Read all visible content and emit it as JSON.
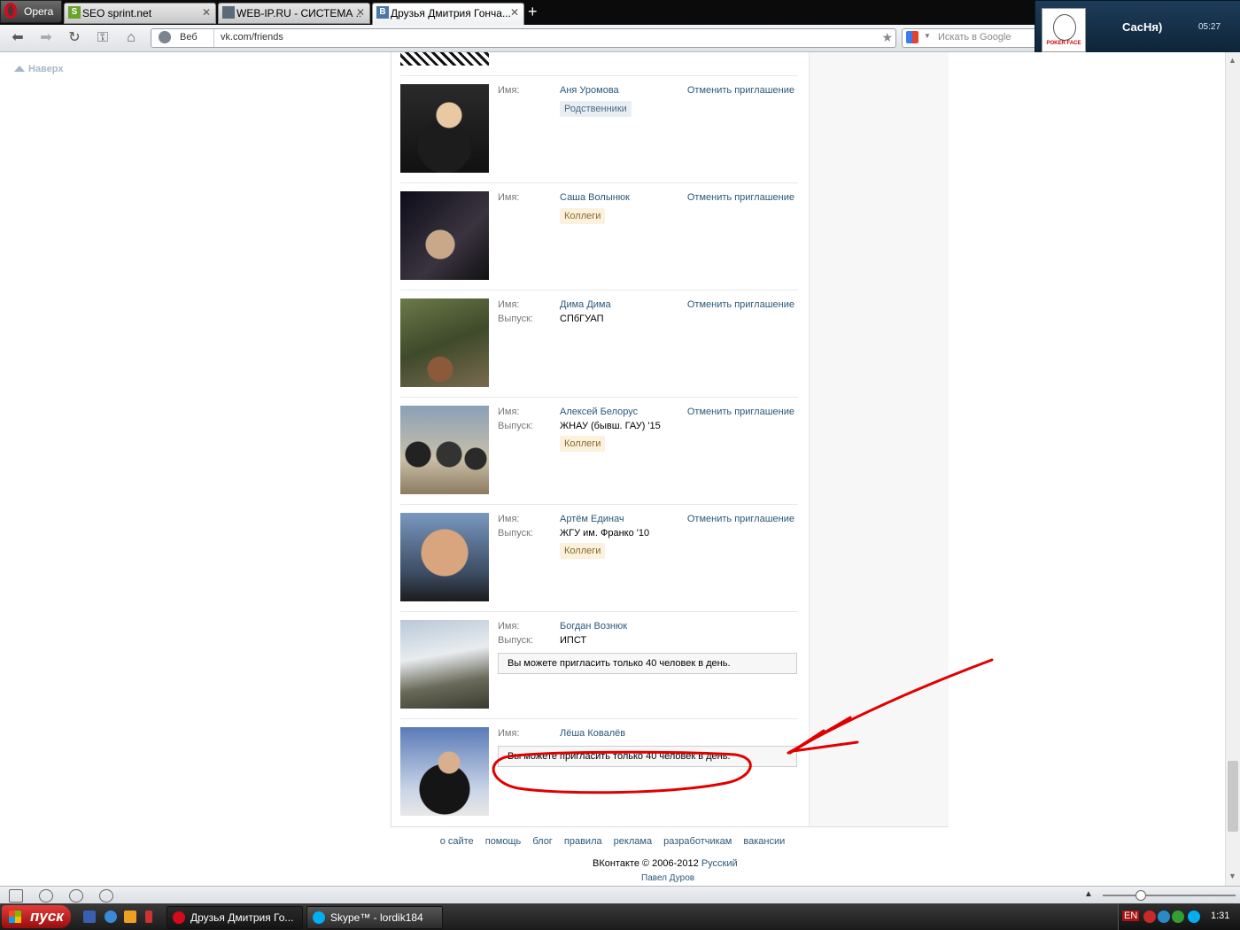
{
  "browser": {
    "menu_label": "Opera",
    "tabs": [
      {
        "title": "SEO sprint.net",
        "favicon": "S",
        "active": false
      },
      {
        "title": "WEB-IP.RU - СИСТЕМА ...",
        "favicon": "",
        "active": false
      },
      {
        "title": "Друзья Дмитрия Гонча...",
        "favicon": "В",
        "active": true
      }
    ],
    "address": {
      "mode": "Веб",
      "url": "vk.com/friends"
    },
    "search_placeholder": "Искать в Google"
  },
  "notification": {
    "name": "СасНя)",
    "time": "05:27",
    "avatar_caption": "POKER FACE"
  },
  "page": {
    "back_to_top": "Наверх",
    "field_labels": {
      "name": "Имя:",
      "grad": "Выпуск:"
    },
    "cancel_label": "Отменить приглашение",
    "limit_notice": "Вы можете пригласить только 40 человек в день.",
    "friends": [
      {
        "name": "Аня Уромова",
        "grad": "",
        "tag": "Родственники",
        "tag_type": "rel",
        "action": "cancel"
      },
      {
        "name": "Саша Волынюк",
        "grad": "",
        "tag": "Коллеги",
        "tag_type": "col",
        "action": "cancel"
      },
      {
        "name": "Дима Дима",
        "grad": "СПбГУАП",
        "tag": "",
        "tag_type": "",
        "action": "cancel"
      },
      {
        "name": "Алексей Белорус",
        "grad": "ЖНАУ (бывш. ГАУ) '15",
        "tag": "Коллеги",
        "tag_type": "col",
        "action": "cancel"
      },
      {
        "name": "Артём Единач",
        "grad": "ЖГУ им. Франко '10",
        "tag": "Коллеги",
        "tag_type": "col",
        "action": "cancel"
      },
      {
        "name": "Богдан Вознюк",
        "grad": "ИПСТ",
        "tag": "",
        "tag_type": "",
        "action": "notice"
      },
      {
        "name": "Лёша Ковалёв",
        "grad": "",
        "tag": "",
        "tag_type": "",
        "action": "notice"
      }
    ],
    "footer": {
      "links": [
        "о сайте",
        "помощь",
        "блог",
        "правила",
        "реклама",
        "разработчикам",
        "вакансии"
      ],
      "copyright": "ВКонтакте © 2006-2012",
      "language": "Русский",
      "author": "Павел Дуров"
    }
  },
  "taskbar": {
    "start_label": "пуск",
    "tasks": [
      {
        "title": "Друзья Дмитрия Го...",
        "active": true
      },
      {
        "title": "Skype™ - lordik184",
        "active": false
      }
    ],
    "lang": "EN",
    "clock": "1:31"
  },
  "colors": {
    "link": "#2b587a",
    "annotation": "#e00000"
  }
}
